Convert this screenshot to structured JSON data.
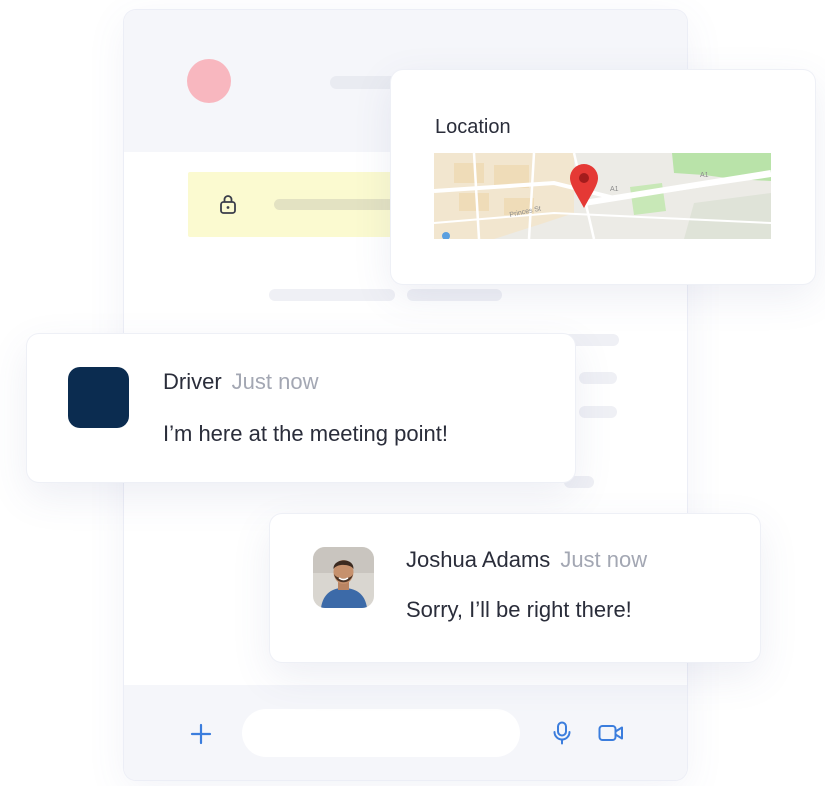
{
  "location_card": {
    "title": "Location",
    "map": {
      "street_labels": [
        "Princes St",
        "A1",
        "A1"
      ],
      "pin_color": "#e53935"
    }
  },
  "messages": [
    {
      "sender": "Driver",
      "time": "Just now",
      "text": "I’m here at the meeting point!",
      "avatar_color": "#0b2c50"
    },
    {
      "sender": "Joshua Adams",
      "time": "Just now",
      "text": "Sorry, I’ll be right there!"
    }
  ],
  "composer": {
    "placeholder": "",
    "icons": [
      "plus-icon",
      "microphone-icon",
      "video-camera-icon"
    ],
    "accent": "#3b7ddd"
  },
  "theme": {
    "header_avatar_color": "#f8b7bf",
    "banner_color": "#fbfad0",
    "name_color": "#2a2d3a",
    "time_color": "#a3a7b3"
  }
}
